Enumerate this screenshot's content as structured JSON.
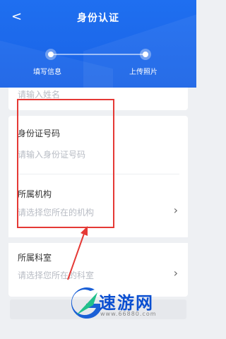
{
  "header": {
    "title": "身份认证",
    "back_symbol": "<"
  },
  "steps": [
    {
      "label": "填写信息"
    },
    {
      "label": "上传照片"
    }
  ],
  "fields": {
    "name": {
      "placeholder": "请输入姓名"
    },
    "id_number": {
      "label": "身份证号码",
      "placeholder": "请输入身份证号码"
    },
    "institution": {
      "label": "所属机构",
      "placeholder": "请选择您所在的机构"
    },
    "department": {
      "label": "所属科室",
      "placeholder": "请选择您所在的科室"
    }
  },
  "chevron_symbol": "›",
  "watermark": {
    "text": "速游网",
    "url": "www.66880.com"
  },
  "colors": {
    "primary": "#1a63e6",
    "annotation": "#e53935"
  }
}
